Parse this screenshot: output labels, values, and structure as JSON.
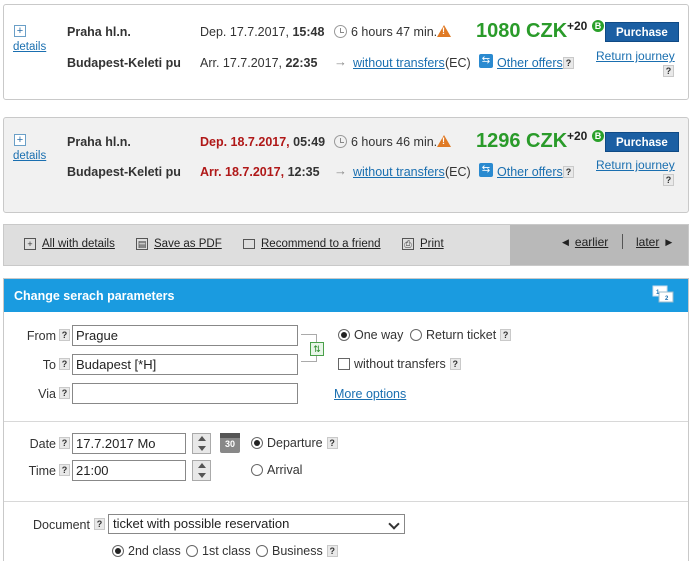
{
  "connections": [
    {
      "details": "details",
      "from": "Praha hl.n.",
      "to": "Budapest-Keleti pu",
      "dep_prefix": "Dep. 17.7.2017, ",
      "dep_time": "15:48",
      "arr_prefix": "Arr. 17.7.2017, ",
      "arr_time": "22:35",
      "duration": "6 hours 47 min.",
      "transfers": "without transfers",
      "train_type": "(EC)",
      "price": "1080 CZK",
      "extra": "+20",
      "purchase": "Purchase",
      "other_offers": "Other offers",
      "return_journey": "Return journey",
      "highlight_dates": false
    },
    {
      "details": "details",
      "from": "Praha hl.n.",
      "to": "Budapest-Keleti pu",
      "dep_prefix": "Dep. 18.7.2017, ",
      "dep_time": "05:49",
      "arr_prefix": "Arr. 18.7.2017, ",
      "arr_time": "12:35",
      "duration": "6 hours 46 min.",
      "transfers": "without transfers",
      "train_type": "(EC)",
      "price": "1296 CZK",
      "extra": "+20",
      "purchase": "Purchase",
      "other_offers": "Other offers",
      "return_journey": "Return journey",
      "highlight_dates": true
    }
  ],
  "toolbar": {
    "all_details": "All with details",
    "save_pdf": "Save as PDF",
    "recommend": "Recommend to a friend",
    "print": "Print",
    "earlier": "earlier",
    "later": "later"
  },
  "search": {
    "title": "Change serach parameters",
    "from_label": "From",
    "from_value": "Prague",
    "to_label": "To",
    "to_value": "Budapest [*H]",
    "via_label": "Via",
    "via_value": "",
    "one_way": "One way",
    "return_ticket": "Return ticket",
    "without_transfers": "without transfers",
    "more_options": "More options",
    "date_label": "Date",
    "date_value": "17.7.2017 Mo",
    "time_label": "Time",
    "time_value": "21:00",
    "calendar_day": "30",
    "departure": "Departure",
    "arrival": "Arrival",
    "document_label": "Document",
    "document_value": "ticket with possible reservation",
    "class_2": "2nd class",
    "class_1": "1st class",
    "business": "Business"
  },
  "help_mark": "?",
  "colors": {
    "accent": "#1a9be0",
    "price": "#2a9b2a",
    "purchase": "#1b5fa3",
    "alert": "#b01818"
  }
}
